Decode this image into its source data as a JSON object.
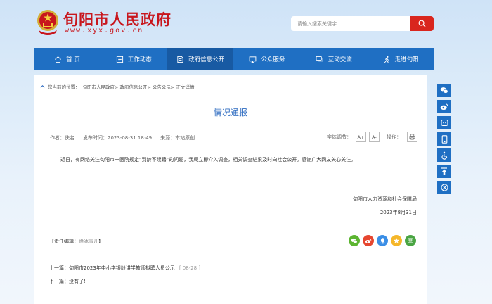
{
  "header": {
    "site_name": "旬阳市人民政府",
    "domain": "www.xyx.gov.cn",
    "search_placeholder": "请输入搜索关键字"
  },
  "nav": {
    "items": [
      {
        "label": "首 页",
        "icon": "home-icon"
      },
      {
        "label": "工作动态",
        "icon": "news-icon"
      },
      {
        "label": "政府信息公开",
        "icon": "document-icon"
      },
      {
        "label": "公众服务",
        "icon": "monitor-icon"
      },
      {
        "label": "互动交流",
        "icon": "chat-icon"
      },
      {
        "label": "走进旬阳",
        "icon": "walk-icon"
      }
    ],
    "active_index": 2
  },
  "breadcrumb": {
    "prefix": "您当前的位置：",
    "items": [
      "旬阳市人民政府",
      "政府信息公开",
      "公告公示",
      "正文详情"
    ]
  },
  "article": {
    "title": "情况通报",
    "author": "作者：佚名",
    "published": "发布时间：2023-08-31 18:49",
    "source": "来源：本站原创",
    "font_size_label": "字体调节：",
    "font_increase": "A+",
    "font_decrease": "A-",
    "operate_label": "操作：",
    "body": "近日，有网络关注旬阳市一医院规定“到龄不续聘”的问题，我局立即介入调查，相关调查结果及时向社会公开。感谢广大网友关心关注。",
    "signer": "旬阳市人力资源和社会保障局",
    "sign_date": "2023年8月31日",
    "editor_label": "【责任编辑：",
    "editor_name": "徐冰雪儿",
    "editor_close": "】"
  },
  "pager": {
    "prev_label": "上一篇：",
    "prev_title": "旬阳市2023年中小学银龄讲学教师拟聘人员公示",
    "prev_date": "[ 08-28 ]",
    "next_label": "下一篇：",
    "next_title": "没有了!"
  },
  "share": [
    {
      "name": "wechat-icon",
      "color": "#5cb531"
    },
    {
      "name": "weibo-icon",
      "color": "#e6462f"
    },
    {
      "name": "qq-icon",
      "color": "#3a8ee6"
    },
    {
      "name": "qzone-icon",
      "color": "#f5b72a"
    },
    {
      "name": "douban-icon",
      "color": "#4aa543",
      "glyph": "豆"
    }
  ],
  "colors": {
    "brand_red": "#c8161d",
    "nav_blue": "#1f6fc3",
    "nav_active": "#185aa3",
    "title_blue": "#2d6bc0"
  }
}
